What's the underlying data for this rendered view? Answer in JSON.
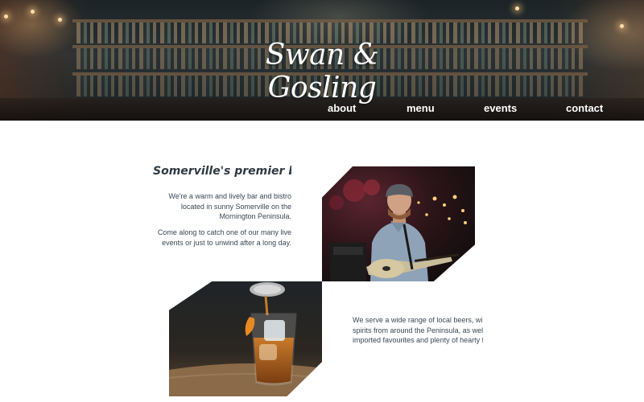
{
  "brand": {
    "logo_text": "Swan & Gosling"
  },
  "nav": {
    "items": [
      {
        "label": "about"
      },
      {
        "label": "menu"
      },
      {
        "label": "events"
      },
      {
        "label": "contact"
      }
    ]
  },
  "intro": {
    "heading": "Somerville's premier bar",
    "paragraph_1": "We're a warm and lively bar and bistro located in sunny Somerville on the Mornington Peninsula.",
    "paragraph_2": "Come along to catch one of our many live events or just to unwind after a long day."
  },
  "drinks": {
    "lines": [
      "We serve a wide range of local beers, wines and",
      "spirits from around the Peninsula, as well as",
      "imported favourites and plenty of hearty food."
    ]
  }
}
